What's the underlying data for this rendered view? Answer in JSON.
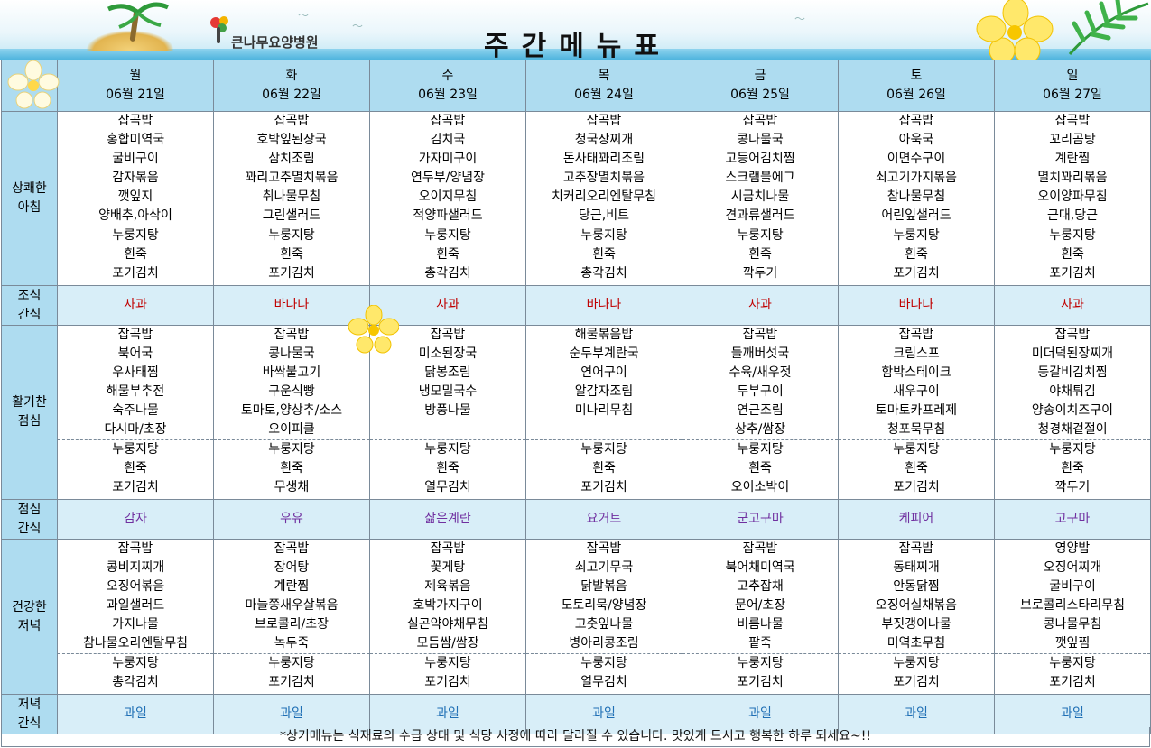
{
  "header": {
    "hospital_name": "큰나무요양병원",
    "title": "주간메뉴표"
  },
  "days": [
    {
      "day": "월",
      "date": "06월 21일"
    },
    {
      "day": "화",
      "date": "06월 22일"
    },
    {
      "day": "수",
      "date": "06월 23일"
    },
    {
      "day": "목",
      "date": "06월 24일"
    },
    {
      "day": "금",
      "date": "06월 25일"
    },
    {
      "day": "토",
      "date": "06월 26일"
    },
    {
      "day": "일",
      "date": "06월 27일"
    }
  ],
  "rows": {
    "breakfast": {
      "label_lines": [
        "상쾌한",
        "아침"
      ],
      "main": [
        [
          "잡곡밥",
          "홍합미역국",
          "굴비구이",
          "감자볶음",
          "깻잎지",
          "양배추,아삭이"
        ],
        [
          "잡곡밥",
          "호박잎된장국",
          "삼치조림",
          "꽈리고추멸치볶음",
          "취나물무침",
          "그린샐러드"
        ],
        [
          "잡곡밥",
          "김치국",
          "가자미구이",
          "연두부/양념장",
          "오이지무침",
          "적양파샐러드"
        ],
        [
          "잡곡밥",
          "청국장찌개",
          "돈사태꽈리조림",
          "고추장멸치볶음",
          "치커리오리엔탈무침",
          "당근,비트"
        ],
        [
          "잡곡밥",
          "콩나물국",
          "고등어김치찜",
          "스크램블에그",
          "시금치나물",
          "견과류샐러드"
        ],
        [
          "잡곡밥",
          "아욱국",
          "이면수구이",
          "쇠고기가지볶음",
          "참나물무침",
          "어린잎샐러드"
        ],
        [
          "잡곡밥",
          "꼬리곰탕",
          "계란찜",
          "멸치꽈리볶음",
          "오이양파무침",
          "근대,당근"
        ]
      ],
      "sub": [
        [
          "누룽지탕",
          "흰죽",
          "포기김치"
        ],
        [
          "누룽지탕",
          "흰죽",
          "포기김치"
        ],
        [
          "누룽지탕",
          "흰죽",
          "총각김치"
        ],
        [
          "누룽지탕",
          "흰죽",
          "총각김치"
        ],
        [
          "누룽지탕",
          "흰죽",
          "깍두기"
        ],
        [
          "누룽지탕",
          "흰죽",
          "포기김치"
        ],
        [
          "누룽지탕",
          "흰죽",
          "포기김치"
        ]
      ]
    },
    "morning_snack": {
      "label_lines": [
        "조식",
        "간식"
      ],
      "items": [
        "사과",
        "바나나",
        "사과",
        "바나나",
        "사과",
        "바나나",
        "사과"
      ]
    },
    "lunch": {
      "label_lines": [
        "활기찬",
        "점심"
      ],
      "main": [
        [
          "잡곡밥",
          "북어국",
          "우사태찜",
          "해물부추전",
          "숙주나물",
          "다시마/초장"
        ],
        [
          "잡곡밥",
          "콩나물국",
          "바싹불고기",
          "구운식빵",
          "토마토,양상추/소스",
          "오이피클"
        ],
        [
          "잡곡밥",
          "미소된장국",
          "닭봉조림",
          "냉모밀국수",
          "방풍나물",
          ""
        ],
        [
          "해물볶음밥",
          "순두부계란국",
          "연어구이",
          "알감자조림",
          "미나리무침",
          ""
        ],
        [
          "잡곡밥",
          "들깨버섯국",
          "수육/새우젓",
          "두부구이",
          "연근조림",
          "상추/쌈장"
        ],
        [
          "잡곡밥",
          "크림스프",
          "함박스테이크",
          "새우구이",
          "토마토카프레제",
          "청포묵무침"
        ],
        [
          "잡곡밥",
          "미더덕된장찌개",
          "등갈비김치찜",
          "야채튀김",
          "양송이치즈구이",
          "청경채겉절이"
        ]
      ],
      "sub": [
        [
          "누룽지탕",
          "흰죽",
          "포기김치"
        ],
        [
          "누룽지탕",
          "흰죽",
          "무생채"
        ],
        [
          "누룽지탕",
          "흰죽",
          "열무김치"
        ],
        [
          "누룽지탕",
          "흰죽",
          "포기김치"
        ],
        [
          "누룽지탕",
          "흰죽",
          "오이소박이"
        ],
        [
          "누룽지탕",
          "흰죽",
          "포기김치"
        ],
        [
          "누룽지탕",
          "흰죽",
          "깍두기"
        ]
      ]
    },
    "lunch_snack": {
      "label_lines": [
        "점심",
        "간식"
      ],
      "items": [
        "감자",
        "우유",
        "삶은계란",
        "요거트",
        "군고구마",
        "케피어",
        "고구마"
      ]
    },
    "dinner": {
      "label_lines": [
        "건강한",
        "저녁"
      ],
      "main": [
        [
          "잡곡밥",
          "콩비지찌개",
          "오징어볶음",
          "과일샐러드",
          "가지나물",
          "참나물오리엔탈무침"
        ],
        [
          "잡곡밥",
          "장어탕",
          "계란찜",
          "마늘쫑새우살볶음",
          "브로콜리/초장",
          "녹두죽"
        ],
        [
          "잡곡밥",
          "꽃게탕",
          "제육볶음",
          "호박가지구이",
          "실곤약야채무침",
          "모듬쌈/쌈장"
        ],
        [
          "잡곡밥",
          "쇠고기무국",
          "닭발볶음",
          "도토리묵/양념장",
          "고춧잎나물",
          "병아리콩조림"
        ],
        [
          "잡곡밥",
          "북어채미역국",
          "고추잡채",
          "문어/초장",
          "비름나물",
          "팥죽"
        ],
        [
          "잡곡밥",
          "동태찌개",
          "안동닭찜",
          "오징어실채볶음",
          "부짓갱이나물",
          "미역초무침"
        ],
        [
          "영양밥",
          "오징어찌개",
          "굴비구이",
          "브로콜리스타리무침",
          "콩나물무침",
          "깻잎찜"
        ]
      ],
      "sub": [
        [
          "누룽지탕",
          "총각김치"
        ],
        [
          "누룽지탕",
          "포기김치"
        ],
        [
          "누룽지탕",
          "포기김치"
        ],
        [
          "누룽지탕",
          "열무김치"
        ],
        [
          "누룽지탕",
          "포기김치"
        ],
        [
          "누룽지탕",
          "포기김치"
        ],
        [
          "누룽지탕",
          "포기김치"
        ]
      ]
    },
    "dinner_snack": {
      "label_lines": [
        "저녁",
        "간식"
      ],
      "items": [
        "과일",
        "과일",
        "과일",
        "과일",
        "과일",
        "과일",
        "과일"
      ]
    }
  },
  "footer": "*상기메뉴는 식재료의 수급 상태 및 식당 사정에 따라 달라질 수 있습니다. 맛있게 드시고 행복한 하루 되세요~!!",
  "colors": {
    "header_bg": "#aedcf0",
    "snack_bg": "#d8eef8",
    "morning_snack_text": "#c00000",
    "lunch_snack_text": "#7030a0",
    "dinner_snack_text": "#1f6fb5"
  },
  "icons": [
    "palm-tree-icon",
    "tree-logo-icon",
    "plumeria-flower-icon",
    "palm-leaf-icon",
    "bird-icon"
  ]
}
